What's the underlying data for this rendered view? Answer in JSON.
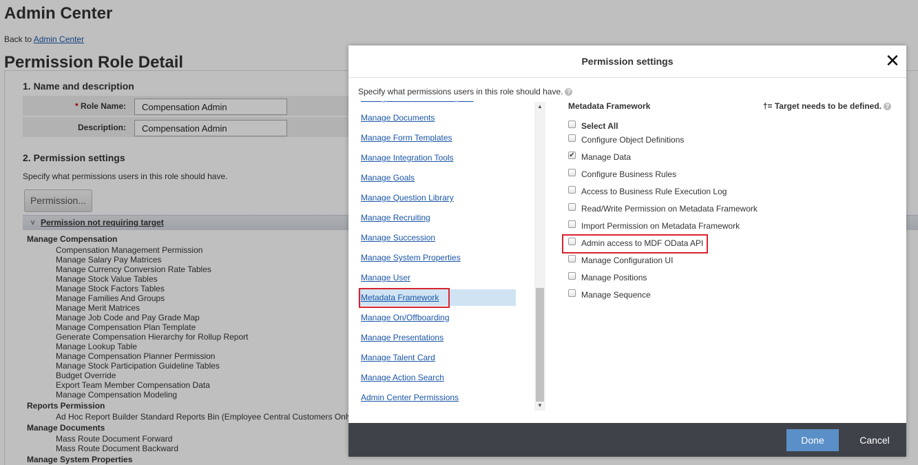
{
  "app_title": "Admin Center",
  "back": {
    "prefix": "Back to ",
    "link": "Admin Center"
  },
  "page_title": "Permission Role Detail",
  "section1": {
    "title": "1. Name and description",
    "role_name_label": "Role Name:",
    "role_name_required": "*",
    "role_name_value": "Compensation Admin",
    "description_label": "Description:",
    "description_value": "Compensation Admin"
  },
  "section2": {
    "title": "2. Permission settings",
    "description": "Specify what permissions users in this role should have.",
    "permission_button": "Permission...",
    "bar_chevron": "v",
    "bar_label": "Permission not requiring target",
    "groups": [
      {
        "name": "Manage Compensation",
        "items": [
          "Compensation Management Permission",
          "Manage Salary Pay Matrices",
          "Manage Currency Conversion Rate Tables",
          "Manage Stock Value Tables",
          "Manage Stock Factors Tables",
          "Manage Families And Groups",
          "Manage Merit Matrices",
          "Manage Job Code and Pay Grade Map",
          "Manage Compensation Plan Template",
          "Generate Compensation Hierarchy for Rollup Report",
          "Manage Lookup Table",
          "Manage Compensation Planner Permission",
          "Manage Stock Participation Guideline Tables",
          "Budget Override",
          "Export Team Member Compensation Data",
          "Manage Compensation Modeling"
        ]
      },
      {
        "name": "Reports Permission",
        "items": [
          "Ad Hoc Report Builder Standard Reports Bin (Employee Central Customers Only)"
        ]
      },
      {
        "name": "Manage Documents",
        "items": [
          "Mass Route Document Forward",
          "Mass Route Document Backward"
        ]
      },
      {
        "name": "Manage System Properties",
        "items": []
      }
    ]
  },
  "modal": {
    "title": "Permission settings",
    "close_glyph": "✕",
    "intro": "Specify what permissions users in this role should have.",
    "help_glyph": "?",
    "categories": [
      "Manage Dashboards / Reports",
      "Manage Documents",
      "Manage Form Templates",
      "Manage Integration Tools",
      "Manage Goals",
      "Manage Question Library",
      "Manage Recruiting",
      "Manage Succession",
      "Manage System Properties",
      "Manage User",
      "Metadata Framework",
      "Manage On/Offboarding",
      "Manage Presentations",
      "Manage Talent Card",
      "Manage Action Search",
      "Admin Center Permissions"
    ],
    "selected_category": "Metadata Framework",
    "scroll_up": "▲",
    "scroll_down": "▼",
    "right_title": "Metadata Framework",
    "target_note": "†= Target needs to be defined.",
    "select_all": "Select All",
    "options": [
      {
        "label": "Configure Object Definitions",
        "checked": false
      },
      {
        "label": "Manage Data",
        "checked": true
      },
      {
        "label": "Configure Business Rules",
        "checked": false
      },
      {
        "label": "Access to Business Rule Execution Log",
        "checked": false
      },
      {
        "label": "Read/Write Permission on Metadata Framework",
        "checked": false
      },
      {
        "label": "Import Permission on Metadata Framework",
        "checked": false
      },
      {
        "label": "Admin access to MDF OData API",
        "checked": false
      },
      {
        "label": "Manage Configuration UI",
        "checked": false
      },
      {
        "label": "Manage Positions",
        "checked": false
      },
      {
        "label": "Manage Sequence",
        "checked": false
      }
    ],
    "highlighted_option": "Admin access to MDF OData API",
    "check_glyph": "✔",
    "done": "Done",
    "cancel": "Cancel"
  },
  "colors": {
    "link": "#1a56a8",
    "highlight_border": "#d9232d",
    "selected_row": "#cfe3f3",
    "footer": "#3f4349",
    "done_button": "#5b8fc7"
  }
}
